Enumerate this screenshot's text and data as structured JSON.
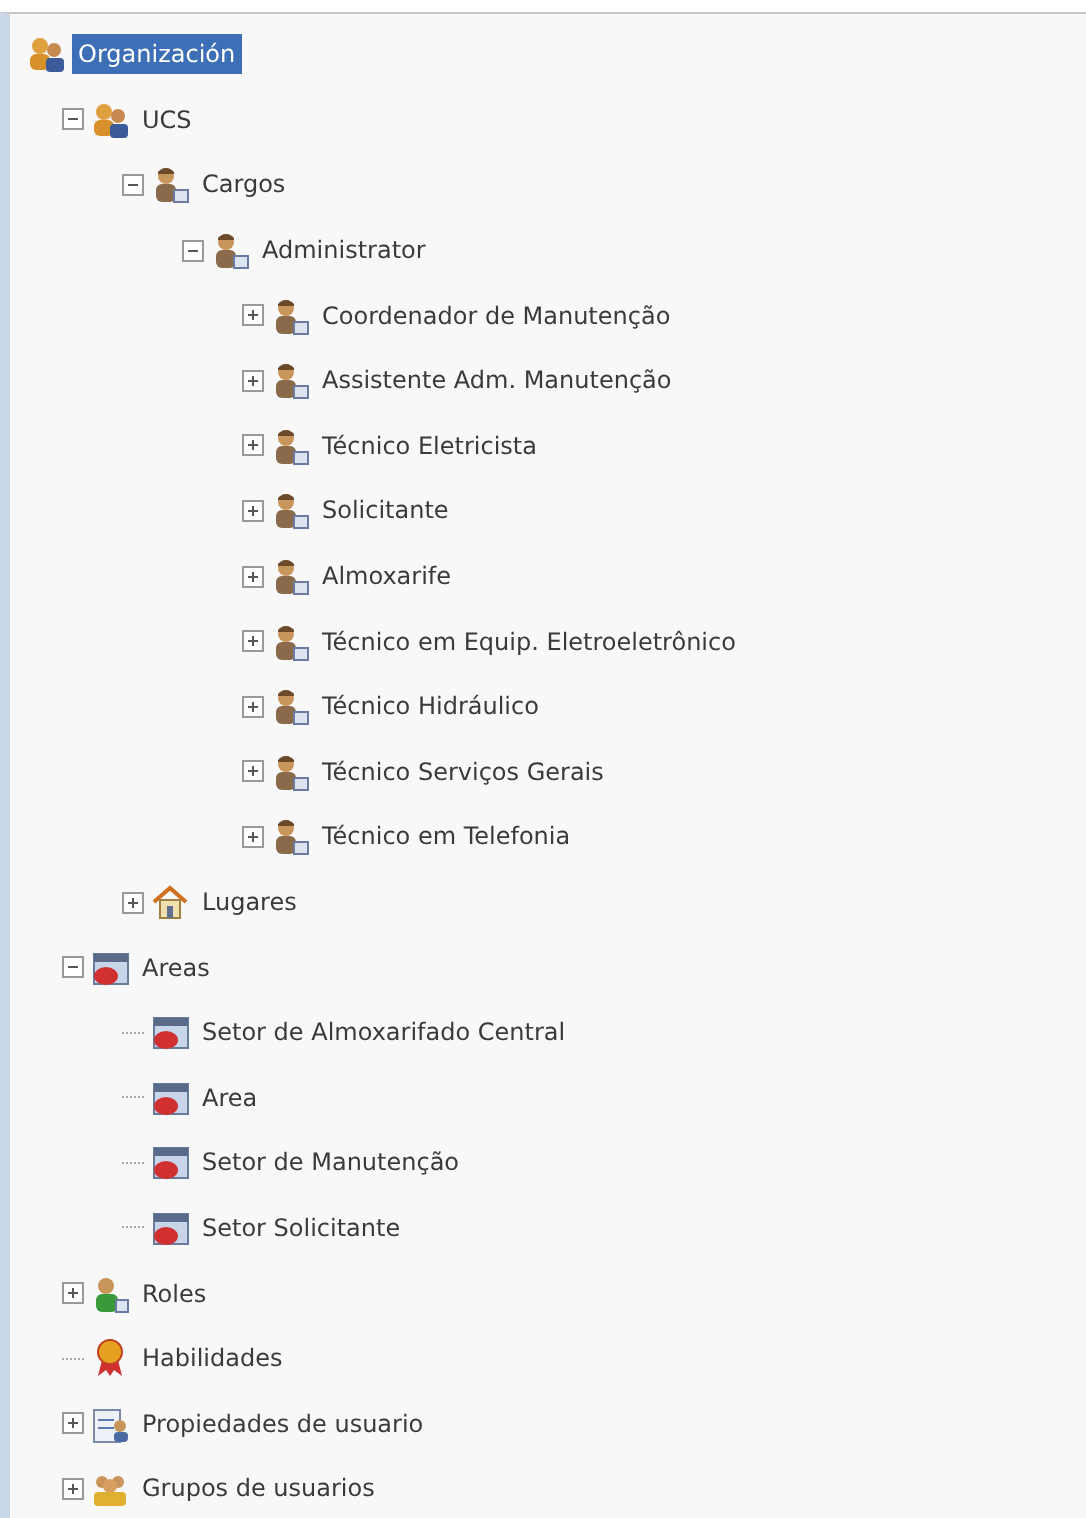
{
  "tree": [
    {
      "label": "Organización",
      "kind": "group",
      "selected": true,
      "children": [
        {
          "label": "UCS",
          "kind": "group",
          "selected": false,
          "expanded": true,
          "children": [
            {
              "label": "Cargos",
              "kind": "person",
              "selected": false,
              "expanded": true,
              "children": [
                {
                  "label": "Administrator",
                  "kind": "person",
                  "selected": false,
                  "expanded": true,
                  "children": [
                    {
                      "label": "Coordenador de Manutenção",
                      "kind": "person",
                      "selected": false,
                      "expanded": false
                    },
                    {
                      "label": "Assistente Adm. Manutenção",
                      "kind": "person",
                      "selected": false,
                      "expanded": false
                    },
                    {
                      "label": "Técnico Eletricista",
                      "kind": "person",
                      "selected": false,
                      "expanded": false
                    },
                    {
                      "label": "Solicitante",
                      "kind": "person",
                      "selected": false,
                      "expanded": false
                    },
                    {
                      "label": "Almoxarife",
                      "kind": "person",
                      "selected": false,
                      "expanded": false
                    },
                    {
                      "label": "Técnico em Equip. Eletroeletrônico",
                      "kind": "person",
                      "selected": false,
                      "expanded": false
                    },
                    {
                      "label": "Técnico Hidráulico",
                      "kind": "person",
                      "selected": false,
                      "expanded": false
                    },
                    {
                      "label": "Técnico Serviços Gerais",
                      "kind": "person",
                      "selected": false,
                      "expanded": false
                    },
                    {
                      "label": "Técnico em Telefonia",
                      "kind": "person",
                      "selected": false,
                      "expanded": false
                    }
                  ]
                }
              ]
            },
            {
              "label": "Lugares",
              "kind": "house",
              "selected": false,
              "expanded": false
            }
          ]
        },
        {
          "label": "Areas",
          "kind": "area",
          "selected": false,
          "expanded": true,
          "children": [
            {
              "label": "Setor de Almoxarifado Central",
              "kind": "area",
              "selected": false
            },
            {
              "label": "Area",
              "kind": "area",
              "selected": false
            },
            {
              "label": "Setor de Manutenção",
              "kind": "area",
              "selected": false
            },
            {
              "label": "Setor Solicitante",
              "kind": "area",
              "selected": false
            }
          ]
        },
        {
          "label": "Roles",
          "kind": "role",
          "selected": false,
          "expanded": false
        },
        {
          "label": "Habilidades",
          "kind": "ribbon",
          "selected": false
        },
        {
          "label": "Propiedades de usuario",
          "kind": "properties",
          "selected": false,
          "expanded": false
        },
        {
          "label": "Grupos de usuarios",
          "kind": "usergroup",
          "selected": false,
          "expanded": false
        }
      ]
    }
  ]
}
